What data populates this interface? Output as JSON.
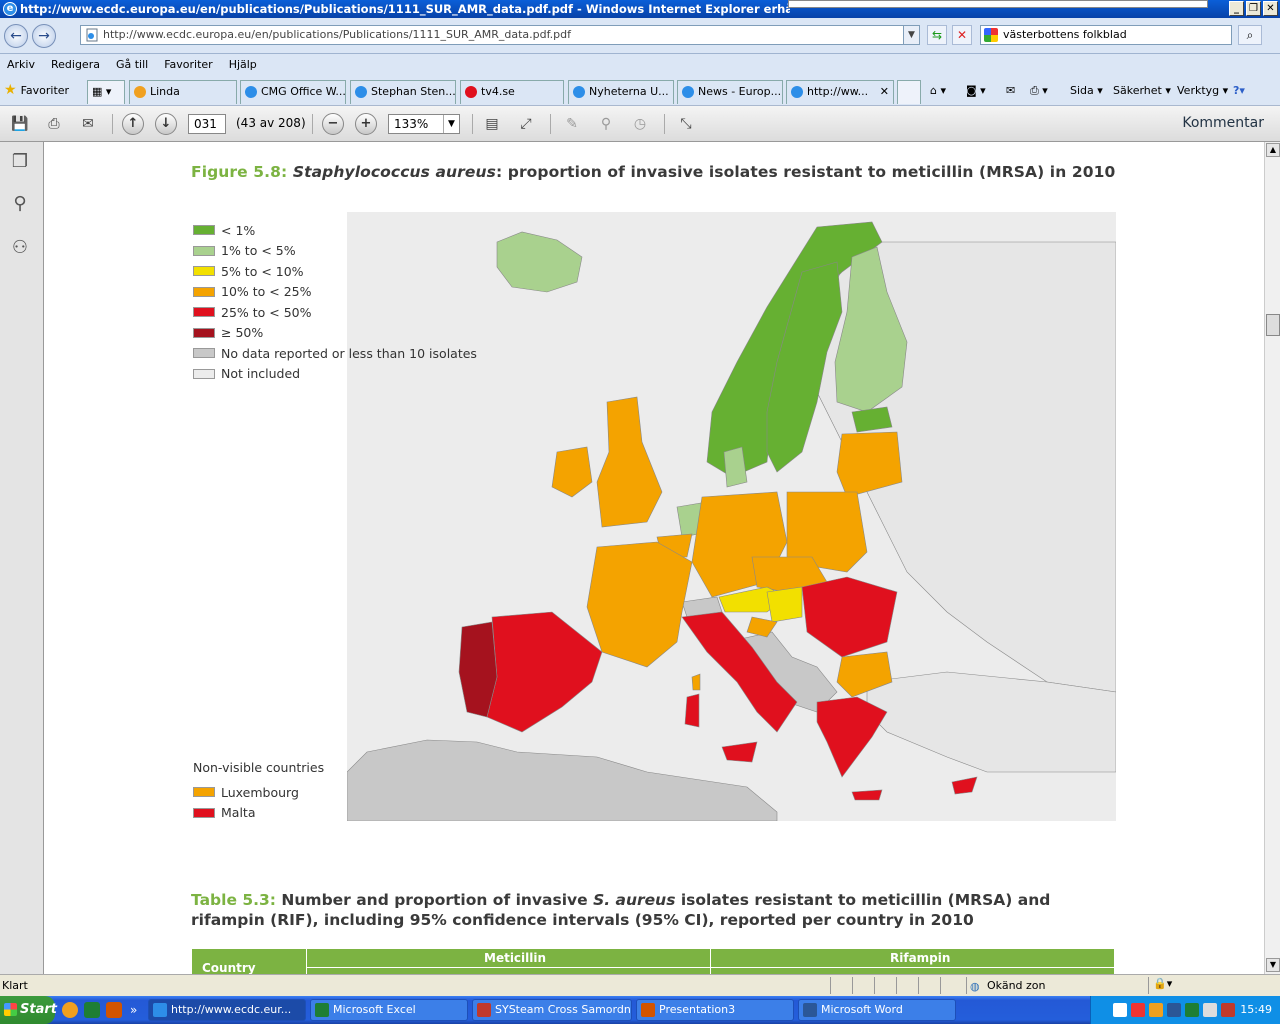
{
  "window": {
    "title": "http://www.ecdc.europa.eu/en/publications/Publications/1111_SUR_AMR_data.pdf.pdf - Windows Internet Explorer erhållet från VLL"
  },
  "address": {
    "url": "http://www.ecdc.europa.eu/en/publications/Publications/1111_SUR_AMR_data.pdf.pdf",
    "search_value": "västerbottens folkblad"
  },
  "menu": [
    "Arkiv",
    "Redigera",
    "Gå till",
    "Favoriter",
    "Hjälp"
  ],
  "favorites": {
    "label": "Favoriter",
    "tabs": [
      {
        "label": "Linda",
        "color": "#fff7cc"
      },
      {
        "label": "CMG Office W...",
        "color": "#fff7cc"
      },
      {
        "label": "Stephan Sten...",
        "color": "#a6e6cc"
      },
      {
        "label": "tv4.se",
        "color": "#a6e6cc"
      },
      {
        "label": "Nyheterna U...",
        "color": "#a6e6cc"
      },
      {
        "label": "News - Europ...",
        "color": "#a6e6cc"
      },
      {
        "label": "http://ww...",
        "color": "#a6e6cc"
      }
    ],
    "commands": [
      "Sida",
      "Säkerhet",
      "Verktyg"
    ]
  },
  "reader": {
    "page": "031",
    "page_count": "(43 av 208)",
    "zoom": "133%",
    "comment_label": "Kommentar"
  },
  "document": {
    "figure_num": "Figure 5.8:",
    "figure_species": "Staphylococcus aureus",
    "figure_rest": ": proportion of invasive isolates resistant to meticillin (MRSA) in 2010",
    "legend": [
      {
        "label": "< 1%",
        "color": "#66b032"
      },
      {
        "label": "1% to < 5%",
        "color": "#a9d18e"
      },
      {
        "label": "5% to < 10%",
        "color": "#f2e000"
      },
      {
        "label": "10% to < 25%",
        "color": "#f4a300"
      },
      {
        "label": "25% to < 50%",
        "color": "#e0101e"
      },
      {
        "label": "≥ 50%",
        "color": "#a5121e"
      },
      {
        "label": "No data reported or less than 10 isolates",
        "color": "#c8c8c8"
      },
      {
        "label": "Not included",
        "color": "#ececec"
      }
    ],
    "nonvisible_title": "Non-visible countries",
    "nonvisible": [
      {
        "label": "Luxembourg",
        "color": "#f4a300"
      },
      {
        "label": "Malta",
        "color": "#e0101e"
      }
    ],
    "table_num": "Table 5.3:",
    "table_title_a": "Number and proportion of invasive",
    "table_title_species": "S. aureus",
    "table_title_b": "isolates resistant to meticillin (MRSA) and rifampin (RIF), including 95% confidence intervals (95% CI), reported per country in 2010",
    "table_headers": {
      "country": "Country",
      "meticillin": "Meticillin",
      "rifampin": "Rifampin"
    }
  },
  "status": {
    "text": "Klart",
    "zone": "Okänd zon"
  },
  "taskbar": {
    "start": "Start",
    "tasks": [
      {
        "label": "http://www.ecdc.eur...",
        "active": true,
        "color": "#2d8ee8"
      },
      {
        "label": "Microsoft Excel",
        "active": false,
        "color": "#1e7e34"
      },
      {
        "label": "SYSteam Cross Samordn...",
        "active": false,
        "color": "#c0392b"
      },
      {
        "label": "Presentation3",
        "active": false,
        "color": "#d35400"
      },
      {
        "label": "Microsoft Word",
        "active": false,
        "color": "#2b5797"
      }
    ],
    "clock": "15:49"
  },
  "colors": {
    "green": "#66b032",
    "lightgreen": "#a9d18e",
    "yellow": "#f2e000",
    "orange": "#f4a300",
    "red": "#e0101e",
    "darkred": "#a5121e",
    "nodata": "#c8c8c8",
    "notincluded": "#ececec",
    "heading_green": "#7cb342"
  }
}
